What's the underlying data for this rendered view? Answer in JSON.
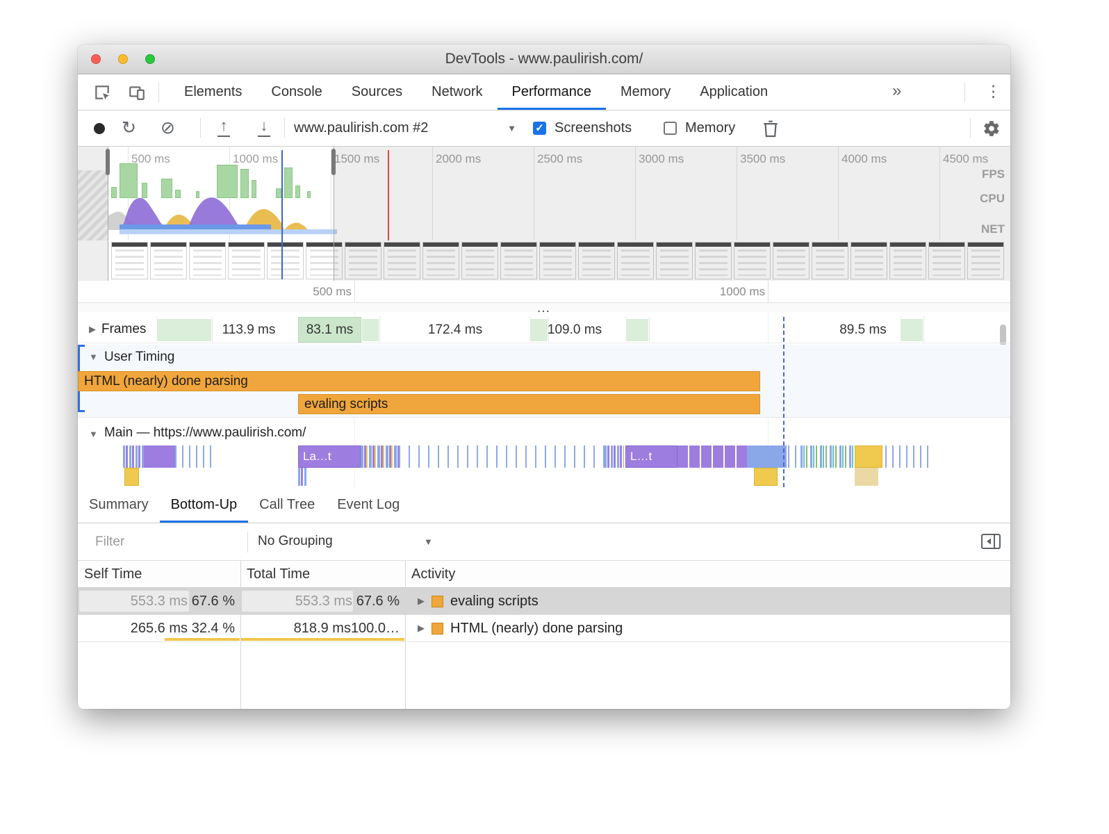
{
  "window": {
    "title": "DevTools - www.paulirish.com/"
  },
  "tab_bar": {
    "tabs": [
      {
        "label": "Elements"
      },
      {
        "label": "Console"
      },
      {
        "label": "Sources"
      },
      {
        "label": "Network"
      },
      {
        "label": "Performance"
      },
      {
        "label": "Memory"
      },
      {
        "label": "Application"
      }
    ],
    "overflow": "»",
    "menu": "⋮"
  },
  "toolbar": {
    "profile": "www.paulirish.com #2",
    "screenshots_label": "Screenshots",
    "memory_label": "Memory"
  },
  "overview": {
    "ticks": [
      "500 ms",
      "1000 ms",
      "1500 ms",
      "2000 ms",
      "2500 ms",
      "3000 ms",
      "3500 ms",
      "4000 ms",
      "4500 ms"
    ],
    "lanes": [
      "FPS",
      "CPU",
      "NET"
    ]
  },
  "detail_ruler": {
    "ticks": [
      "500 ms",
      "1000 ms"
    ]
  },
  "frames": {
    "label": "Frames",
    "durations": [
      "113.9 ms",
      "83.1 ms",
      "172.4 ms",
      "109.0 ms",
      "89.5 ms"
    ]
  },
  "user_timing": {
    "label": "User Timing",
    "bars": [
      "HTML (nearly) done parsing",
      "evaling scripts"
    ]
  },
  "main_track": {
    "label": "Main — https://www.paulirish.com/",
    "bars": [
      "La…t",
      "L…t"
    ]
  },
  "bottom_tabs": [
    "Summary",
    "Bottom-Up",
    "Call Tree",
    "Event Log"
  ],
  "filter_bar": {
    "filter_placeholder": "Filter",
    "grouping": "No Grouping"
  },
  "table": {
    "columns": [
      "Self Time",
      "Total Time",
      "Activity"
    ],
    "rows": [
      {
        "self_time": "553.3 ms",
        "self_pct": "67.6 %",
        "total_time": "553.3 ms",
        "total_pct": "67.6 %",
        "activity": "evaling scripts"
      },
      {
        "self_time": "265.6 ms",
        "self_pct": "32.4 %",
        "total_time": "818.9 ms",
        "total_pct": "100.0…",
        "activity": "HTML (nearly) done parsing"
      }
    ]
  },
  "icons": {
    "reload": "↻",
    "clear": "⊘",
    "import_arrow": "↑",
    "export_arrow": "↓",
    "caret": "▼",
    "check": "✓",
    "overflow": "»",
    "menu": "⋮",
    "expand": "▶",
    "collapse": "▼",
    "dots": "…"
  },
  "colors": {
    "accent_blue": "#1a73e8",
    "user_timing_orange": "#f0a63c",
    "frame_green": "#cbe6cb",
    "flame_purple": "#9d7de0",
    "flame_blue": "#8aa7e8",
    "flame_yellow": "#f0c94f",
    "pct_bar_yellow": "#f2c64a",
    "selected_row_gray": "#d6d6d6"
  }
}
